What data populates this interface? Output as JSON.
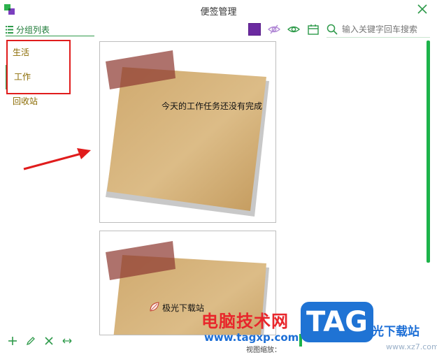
{
  "window": {
    "title": "便签管理"
  },
  "sidebar": {
    "header_label": "分组列表",
    "items": [
      {
        "label": "生活"
      },
      {
        "label": "工作"
      },
      {
        "label": "回收站"
      }
    ]
  },
  "toolbar": {
    "color_swatch": "#6b2aa0",
    "search_placeholder": "输入关键字回车搜索"
  },
  "notes": [
    {
      "text": "今天的工作任务还没有完成"
    },
    {
      "text": "极光下载站"
    }
  ],
  "footer": {
    "zoom_label": "视图缩放："
  },
  "watermark": {
    "cn": "电脑技术网",
    "url": "www.tagxp.com",
    "tag": "TAG",
    "right": "光下载站",
    "url2": "www.xz7.com"
  },
  "colors": {
    "accent": "#2e9a4a",
    "highlight": "#e01c1c",
    "paper": "#d2ad72",
    "tape": "#9a4a3e"
  }
}
